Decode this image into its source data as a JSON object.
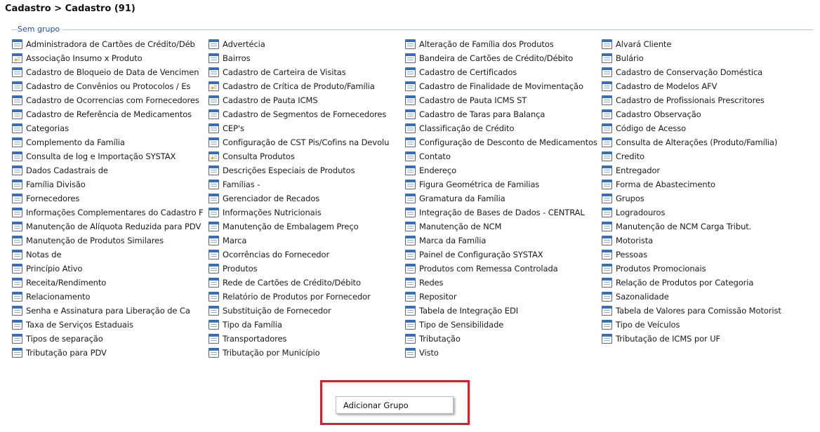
{
  "header": {
    "title": "Cadastro > Cadastro (91)"
  },
  "group": {
    "label": "Sem grupo"
  },
  "columns": [
    [
      {
        "label": "Administradora de Cartões de Crédito/Déb",
        "icon": "table-icon"
      },
      {
        "label": "Associação Insumo x Produto",
        "icon": "table-star-icon"
      },
      {
        "label": "Cadastro de Bloqueio de Data de Vencimen",
        "icon": "table-icon"
      },
      {
        "label": "Cadastro de Convênios ou Protocolos / Es",
        "icon": "table-icon"
      },
      {
        "label": "Cadastro de Ocorrencias com Fornecedores",
        "icon": "table-icon"
      },
      {
        "label": "Cadastro de Referência de Medicamentos",
        "icon": "table-icon"
      },
      {
        "label": "Categorias",
        "icon": "table-icon"
      },
      {
        "label": "Complemento da Família",
        "icon": "table-icon"
      },
      {
        "label": "Consulta de log e Importação SYSTAX",
        "icon": "table-icon"
      },
      {
        "label": "Dados Cadastrais de",
        "icon": "table-icon"
      },
      {
        "label": "Família Divisão",
        "icon": "table-icon"
      },
      {
        "label": "Fornecedores",
        "icon": "table-icon"
      },
      {
        "label": "Informações Complementares do Cadastro F",
        "icon": "table-icon"
      },
      {
        "label": "Manutenção de Alíquota Reduzida para PDV",
        "icon": "table-icon"
      },
      {
        "label": "Manutenção de Produtos Similares",
        "icon": "table-icon"
      },
      {
        "label": "Notas de",
        "icon": "table-icon"
      },
      {
        "label": "Princípio Ativo",
        "icon": "table-icon"
      },
      {
        "label": "Receita/Rendimento",
        "icon": "table-icon"
      },
      {
        "label": "Relacionamento",
        "icon": "table-icon"
      },
      {
        "label": "Senha e  Assinatura para Liberação de Ca",
        "icon": "table-icon"
      },
      {
        "label": "Taxa de Serviços Estaduais",
        "icon": "table-icon"
      },
      {
        "label": "Tipos de separação",
        "icon": "table-icon"
      },
      {
        "label": "Tributação para PDV",
        "icon": "table-icon"
      }
    ],
    [
      {
        "label": "Advertécia",
        "icon": "table-icon"
      },
      {
        "label": "Bairros",
        "icon": "table-icon"
      },
      {
        "label": "Cadastro de Carteira de Visitas",
        "icon": "table-icon"
      },
      {
        "label": "Cadastro de Crítica de Produto/Família",
        "icon": "table-star-icon"
      },
      {
        "label": "Cadastro de Pauta ICMS",
        "icon": "table-icon"
      },
      {
        "label": "Cadastro de Segmentos de Fornecedores",
        "icon": "table-icon"
      },
      {
        "label": "CEP's",
        "icon": "table-icon"
      },
      {
        "label": "Configuração de CST Pis/Cofins na Devolu",
        "icon": "table-icon"
      },
      {
        "label": "Consulta Produtos",
        "icon": "table-star-icon"
      },
      {
        "label": "Descrições Especiais de Produtos",
        "icon": "table-icon"
      },
      {
        "label": "Famílias -",
        "icon": "table-icon"
      },
      {
        "label": "Gerenciador de Recados",
        "icon": "table-icon"
      },
      {
        "label": "Informações Nutricionais",
        "icon": "table-icon"
      },
      {
        "label": "Manutenção de Embalagem Preço",
        "icon": "table-icon"
      },
      {
        "label": "Marca",
        "icon": "table-icon"
      },
      {
        "label": "Ocorrências do Fornecedor",
        "icon": "table-icon"
      },
      {
        "label": "Produtos",
        "icon": "table-icon"
      },
      {
        "label": "Rede de Cartões de Crédito/Débito",
        "icon": "table-icon"
      },
      {
        "label": "Relatório de Produtos por Fornecedor",
        "icon": "table-icon"
      },
      {
        "label": "Substituição de Fornecedor",
        "icon": "table-icon"
      },
      {
        "label": "Tipo da Família",
        "icon": "table-icon"
      },
      {
        "label": "Transportadores",
        "icon": "table-icon"
      },
      {
        "label": "Tributação por Município",
        "icon": "table-icon"
      }
    ],
    [
      {
        "label": "Alteração de Família dos Produtos",
        "icon": "table-icon"
      },
      {
        "label": "Bandeira de Cartões de Crédito/Débito",
        "icon": "table-icon"
      },
      {
        "label": "Cadastro de Certificados",
        "icon": "table-icon"
      },
      {
        "label": "Cadastro de Finalidade de Movimentação",
        "icon": "table-icon"
      },
      {
        "label": "Cadastro de Pauta ICMS ST",
        "icon": "table-icon"
      },
      {
        "label": "Cadastro de Taras para Balança",
        "icon": "table-icon"
      },
      {
        "label": "Classificação de Crédito",
        "icon": "table-icon"
      },
      {
        "label": "Configuração de Desconto de Medicamentos",
        "icon": "table-icon"
      },
      {
        "label": "Contato",
        "icon": "table-icon"
      },
      {
        "label": "Endereço",
        "icon": "table-icon"
      },
      {
        "label": "Figura Geométrica de Familias",
        "icon": "table-icon"
      },
      {
        "label": "Gramatura da Família",
        "icon": "table-icon"
      },
      {
        "label": "Integração de Bases de Dados - CENTRAL",
        "icon": "table-icon"
      },
      {
        "label": "Manutenção de NCM",
        "icon": "table-icon"
      },
      {
        "label": "Marca da Família",
        "icon": "table-icon"
      },
      {
        "label": "Painel de Configuração SYSTAX",
        "icon": "table-icon"
      },
      {
        "label": "Produtos com Remessa Controlada",
        "icon": "table-icon"
      },
      {
        "label": "Redes",
        "icon": "table-icon"
      },
      {
        "label": "Repositor",
        "icon": "table-icon"
      },
      {
        "label": "Tabela de Integração EDI",
        "icon": "table-icon"
      },
      {
        "label": "Tipo de Sensibilidade",
        "icon": "table-icon"
      },
      {
        "label": "Tributação",
        "icon": "table-icon"
      },
      {
        "label": "Visto",
        "icon": "table-icon"
      }
    ],
    [
      {
        "label": "Alvará Cliente",
        "icon": "table-icon"
      },
      {
        "label": "Bulário",
        "icon": "table-icon"
      },
      {
        "label": "Cadastro de Conservação Doméstica",
        "icon": "table-icon"
      },
      {
        "label": "Cadastro de Modelos AFV",
        "icon": "table-icon"
      },
      {
        "label": "Cadastro de Profissionais Prescritores",
        "icon": "table-icon"
      },
      {
        "label": "Cadastro Observação",
        "icon": "table-icon"
      },
      {
        "label": "Código de Acesso",
        "icon": "table-icon"
      },
      {
        "label": "Consulta de Alterações (Produto/Família)",
        "icon": "table-icon"
      },
      {
        "label": "Credito",
        "icon": "table-icon"
      },
      {
        "label": "Entregador",
        "icon": "table-icon"
      },
      {
        "label": "Forma de Abastecimento",
        "icon": "table-icon"
      },
      {
        "label": "Grupos",
        "icon": "table-icon"
      },
      {
        "label": "Logradouros",
        "icon": "table-icon"
      },
      {
        "label": "Manutenção de NCM Carga Tribut.",
        "icon": "table-icon"
      },
      {
        "label": "Motorista",
        "icon": "table-icon"
      },
      {
        "label": "Pessoas",
        "icon": "table-icon"
      },
      {
        "label": "Produtos Promocionais",
        "icon": "table-icon"
      },
      {
        "label": "Relação de Produtos por Categoria",
        "icon": "table-icon"
      },
      {
        "label": "Sazonalidade",
        "icon": "table-icon"
      },
      {
        "label": "Tabela de Valores para Comissão Motorist",
        "icon": "table-icon"
      },
      {
        "label": "Tipo de Veículos",
        "icon": "table-icon"
      },
      {
        "label": "Tributação de ICMS por UF",
        "icon": "table-icon"
      }
    ]
  ],
  "actions": {
    "add_group_label": "Adicionar Grupo"
  },
  "colors": {
    "accent": "#1f4fa0",
    "icon_blue": "#3a6db5",
    "highlight_red": "#d3232a"
  }
}
